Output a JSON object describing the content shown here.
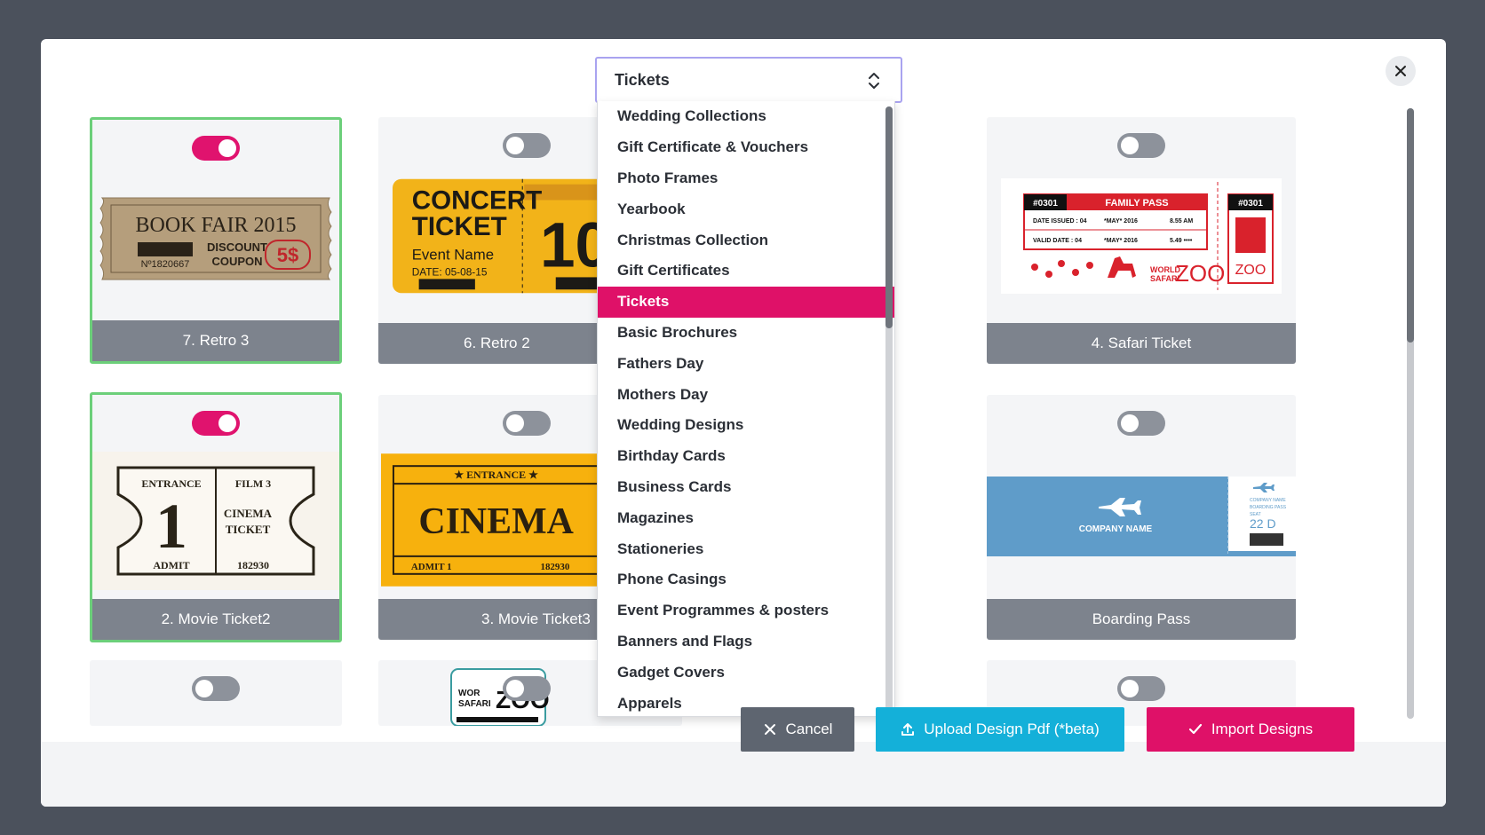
{
  "select": {
    "value": "Tickets"
  },
  "dropdown": {
    "items": [
      "Wedding Collections",
      "Gift Certificate & Vouchers",
      "Photo Frames",
      "Yearbook",
      "Christmas Collection",
      "Gift Certificates",
      "Tickets",
      "Basic Brochures",
      "Fathers Day",
      "Mothers Day",
      "Wedding Designs",
      "Birthday Cards",
      "Business Cards",
      "Magazines",
      "Stationeries",
      "Phone Casings",
      "Event Programmes & posters",
      "Banners and Flags",
      "Gadget Covers",
      "Apparels"
    ],
    "active_index": 6
  },
  "cards": [
    {
      "label": "7. Retro 3",
      "selected": true
    },
    {
      "label": "6. Retro 2",
      "selected": false
    },
    {
      "label": "4. Safari Ticket",
      "selected": false
    },
    {
      "label": "2. Movie Ticket2",
      "selected": true
    },
    {
      "label": "3. Movie Ticket3",
      "selected": false
    },
    {
      "label": "Boarding Pass",
      "selected": false
    }
  ],
  "thumbnails": {
    "retro3": {
      "title": "BOOK FAIR 2015",
      "serial": "Nº1820667",
      "discount": "DISCOUNT",
      "coupon": "COUPON",
      "price": "5$"
    },
    "retro2": {
      "title1": "CONCERT",
      "title2": "TICKET",
      "event": "Event Name",
      "date": "DATE: 05-08-15",
      "number": "10"
    },
    "safari": {
      "id": "#0301",
      "pass": "FAMILY PASS",
      "issued": "DATE ISSUED : 04",
      "issued_month": "*MAY* 2016",
      "issued_time": "8.55 AM",
      "valid": "VALID DATE : 04",
      "valid_month": "*MAY* 2016",
      "valid_time": "5.49 ••••",
      "world": "WORLD",
      "safari_word": "SAFARI",
      "zoo": "ZOO",
      "stub_id": "#0301"
    },
    "movie2": {
      "entrance": "ENTRANCE",
      "number": "1",
      "admit": "ADMIT",
      "film": "FILM 3",
      "cinema": "CINEMA",
      "ticket": "TICKET",
      "code": "182930"
    },
    "movie3": {
      "entrance": "★ ENTRANCE ★",
      "cinema": "CINEMA",
      "admit": "ADMIT 1",
      "code": "182930"
    },
    "boarding": {
      "company": "COMPANY NAME",
      "stub_small": "COMPANY NAME",
      "stub_pass": "BOARDING PASS",
      "seat_label": "SEAT",
      "seat": "22 D"
    },
    "zoo_partial": {
      "line1": "WOR",
      "line2": "SAFARI",
      "zoo": "ZOO"
    }
  },
  "buttons": {
    "cancel": "Cancel",
    "upload": "Upload Design Pdf (*beta)",
    "import": "Import Designs"
  },
  "colors": {
    "accent": "#df1168",
    "selected_border": "#6ccf7a",
    "upload": "#14b0d9"
  }
}
